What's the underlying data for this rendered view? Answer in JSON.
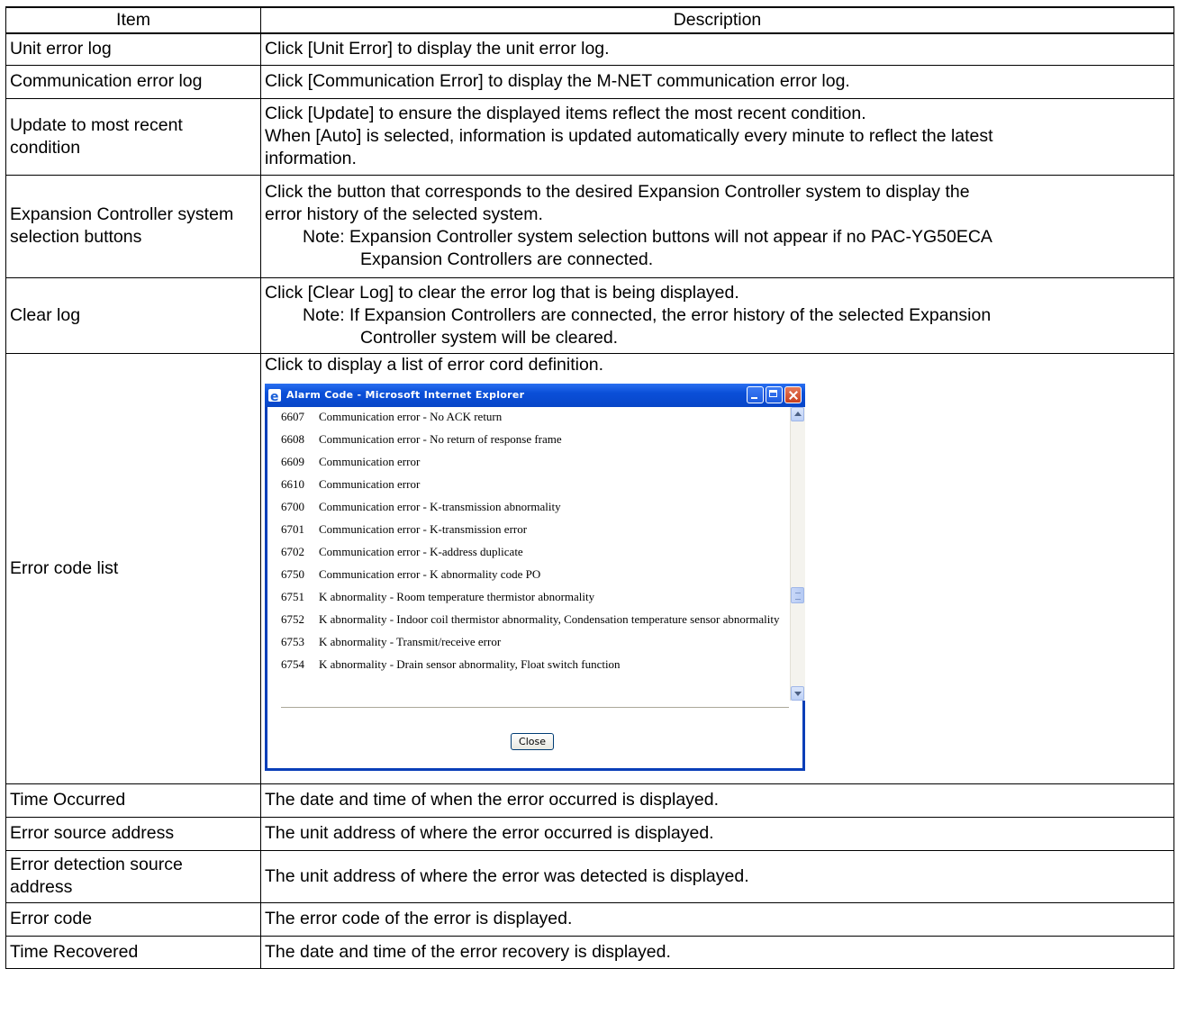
{
  "table": {
    "headers": {
      "item": "Item",
      "description": "Description"
    },
    "rows": [
      {
        "item": "Unit error log",
        "desc": [
          "Click [Unit Error] to display the unit error log."
        ]
      },
      {
        "item": "Communication error log",
        "desc": [
          "Click [Communication Error] to display the M-NET communication error log."
        ]
      },
      {
        "item": "Update to most recent condition",
        "desc": [
          "Click [Update] to ensure the displayed items reflect the most recent condition.",
          "When [Auto] is selected, information is updated automatically every minute to reflect the latest",
          "information."
        ]
      },
      {
        "item": "Expansion Controller system selection buttons",
        "desc": [
          "Click the button that corresponds to the desired Expansion Controller system to display the",
          "error history of the selected system."
        ],
        "note": [
          "Note: Expansion Controller system selection buttons will not appear if no PAC-YG50ECA",
          "Expansion Controllers are connected."
        ]
      },
      {
        "item": "Clear log",
        "desc": [
          "Click [Clear Log] to clear the error log that is being displayed."
        ],
        "note": [
          "Note: If Expansion Controllers are connected, the error history of the selected Expansion",
          "Controller system will be cleared."
        ]
      },
      {
        "item": "Error code list",
        "desc": [
          "Click to display a list of error cord definition."
        ]
      },
      {
        "item": "Time Occurred",
        "desc": [
          "The date and time of when the error occurred is displayed."
        ]
      },
      {
        "item": "Error source address",
        "desc": [
          "The unit address of where the error occurred is displayed."
        ]
      },
      {
        "item": "Error detection source address",
        "desc": [
          "The unit address of where the error was detected is displayed."
        ]
      },
      {
        "item": "Error code",
        "desc": [
          "The error code of the error is displayed."
        ]
      },
      {
        "item": "Time Recovered",
        "desc": [
          "The date and time of the error recovery is displayed."
        ]
      }
    ]
  },
  "popup": {
    "title": "Alarm Code - Microsoft Internet Explorer",
    "close_label": "Close",
    "alarms": [
      {
        "code": "6607",
        "text": "Communication error - No ACK return"
      },
      {
        "code": "6608",
        "text": "Communication error - No return of response frame"
      },
      {
        "code": "6609",
        "text": "Communication error"
      },
      {
        "code": "6610",
        "text": "Communication error"
      },
      {
        "code": "6700",
        "text": "Communication error - K-transmission abnormality"
      },
      {
        "code": "6701",
        "text": "Communication error - K-transmission error"
      },
      {
        "code": "6702",
        "text": "Communication error - K-address duplicate"
      },
      {
        "code": "6750",
        "text": "Communication error - K abnormality code PO"
      },
      {
        "code": "6751",
        "text": "K abnormality - Room temperature thermistor abnormality"
      },
      {
        "code": "6752",
        "text": "K abnormality - Indoor coil thermistor abnormality, Condensation temperature sensor abnormality"
      },
      {
        "code": "6753",
        "text": "K abnormality - Transmit/receive error"
      },
      {
        "code": "6754",
        "text": "K abnormality - Drain sensor abnormality, Float switch function"
      }
    ],
    "icons": [
      "ie-app-icon",
      "minimize-icon",
      "maximize-icon",
      "close-icon",
      "scroll-up-icon",
      "scroll-down-icon"
    ],
    "colors": {
      "titlebar": "#0a4fd8",
      "window_border": "#0a3fb8",
      "close_button": "#c8401e"
    }
  }
}
